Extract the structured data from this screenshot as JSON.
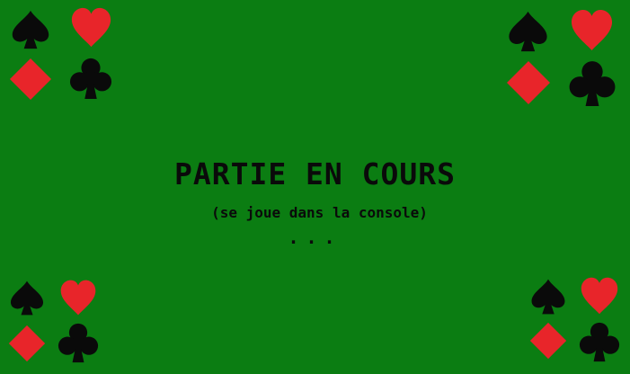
{
  "colors": {
    "felt": "#0b7d12",
    "black_suit": "#0a0a0a",
    "red_suit": "#e8252a",
    "text": "#0a0a0a"
  },
  "status": {
    "title": "PARTIE EN COURS",
    "subtitle": "(se joue dans la console)",
    "dots": "..."
  },
  "corner_icons": [
    "spade-icon",
    "heart-icon",
    "diamond-icon",
    "club-icon"
  ]
}
